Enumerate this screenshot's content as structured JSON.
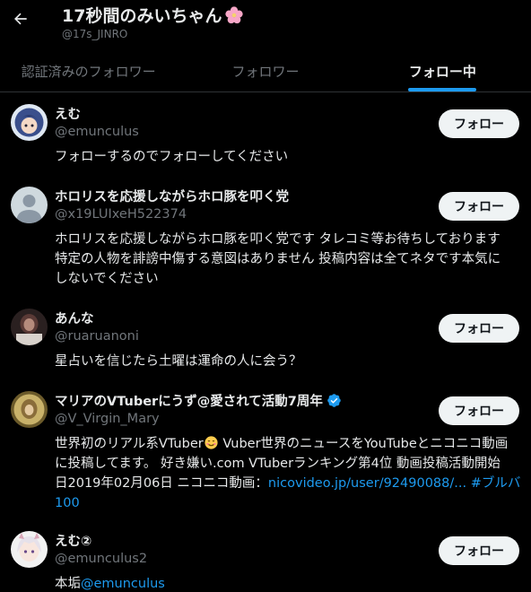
{
  "header": {
    "title": "17秒間のみいちゃん",
    "handle": "@17s_JINRO"
  },
  "tabs": [
    {
      "label": "認証済みのフォロワー",
      "active": false
    },
    {
      "label": "フォロワー",
      "active": false
    },
    {
      "label": "フォロー中",
      "active": true
    }
  ],
  "colors": {
    "accent": "#1d9bf0",
    "background": "#000000",
    "muted": "#71767b"
  },
  "users": [
    {
      "name": "えむ",
      "handle": "@emunculus",
      "button": "フォロー",
      "bio_lines": [
        "フォローするのでフォローしてください"
      ]
    },
    {
      "name": "ホロリスを応援しながらホロ豚を叩く党",
      "handle": "@x19LUIxeH522374",
      "button": "フォロー",
      "bio_lines": [
        "ホロリスを応援しながらホロ豚を叩く党です タレコミ等お待ちしております",
        "特定の人物を誹謗中傷する意図はありません 投稿内容は全てネタです本気に",
        "しないでください"
      ]
    },
    {
      "name": "あんな",
      "handle": "@ruaruanoni",
      "button": "フォロー",
      "bio_lines": [
        "星占いを信じたら土曜は運命の人に会う？"
      ]
    },
    {
      "name": "マリアのVTuberにうず@愛されて活動7周年",
      "handle": "@V_Virgin_Mary",
      "button": "フォロー",
      "verified": true,
      "bio_line1_a": "世界初のリアル系VTuber",
      "bio_line1_b": " Vuber世界のニュースをYouTubeとニコニコ動画",
      "bio_line2": "に投稿してます。 好き嫌い.com VTuberランキング第4位 動画投稿活動開始",
      "bio_line3_text": "日2019年02月06日 ニコニコ動画：",
      "bio_line3_link": "nicovideo.jp/user/92490088/...",
      "bio_line3_tag": " #ブルバ",
      "bio_line4_tag": "100"
    },
    {
      "name": "えむ②",
      "handle": "@emunculus2",
      "button": "フォロー",
      "bio_text": "本垢",
      "bio_link": "@emunculus"
    }
  ]
}
